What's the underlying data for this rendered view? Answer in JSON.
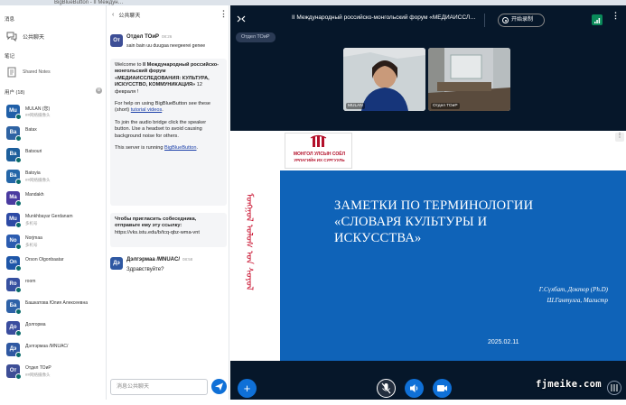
{
  "browser": {
    "tab_active": "BigBlueButton - II Междун…"
  },
  "sidebar": {
    "messages_title": "消息",
    "public_chat_label": "公共聊天",
    "notes_title": "笔记",
    "shared_notes_label": "Shared Notes",
    "users_title": "用户 (18)",
    "users": [
      {
        "initials": "Mu",
        "name": "MULAN (您)",
        "sub": "##网络摄像头",
        "color": "#1f5fa8"
      },
      {
        "initials": "Ba",
        "name": "Batax",
        "sub": "",
        "color": "#2e63a3"
      },
      {
        "initials": "Ba",
        "name": "Batsouri",
        "sub": "",
        "color": "#1d5f9c"
      },
      {
        "initials": "Ba",
        "name": "Batoyia",
        "sub": "##网络摄像头",
        "color": "#2466a8"
      },
      {
        "initials": "Ma",
        "name": "Mandakh",
        "sub": "",
        "color": "#4a3aa0"
      },
      {
        "initials": "Mu",
        "name": "Munkhbayar Gerdanam",
        "sub": "多机号",
        "color": "#2d4aa5"
      },
      {
        "initials": "No",
        "name": "Norjmaa",
        "sub": "多机号",
        "color": "#2b5cb0"
      },
      {
        "initials": "On",
        "name": "Orson Olgonbaatar",
        "sub": "",
        "color": "#1e56a8"
      },
      {
        "initials": "Ro",
        "name": "room",
        "sub": "",
        "color": "#3650a0"
      },
      {
        "initials": "Ба",
        "name": "Башкатова Юлия Алексеевна",
        "sub": "",
        "color": "#2e62a8"
      },
      {
        "initials": "До",
        "name": "Долгорма",
        "sub": "",
        "color": "#3a4d9e"
      },
      {
        "initials": "Дэ",
        "name": "Дэлгэрмаа /MNUAC/",
        "sub": "",
        "color": "#2f58a2"
      },
      {
        "initials": "От",
        "name": "Отдел ТОиР",
        "sub": "##网络摄像头",
        "color": "#3d4e96"
      }
    ]
  },
  "chat": {
    "back_label": "公共聊天",
    "msg1_initials": "От",
    "msg1_name": "Отдел ТОиР",
    "msg1_time": "08:26",
    "msg1_text": "sain bain uu duugaa neegeerei genee",
    "welcome_prefix": "Welcome to",
    "welcome_bold": "II Международный российско-монгольский форум «МЕДИАИССЛЕДОВАНИЯ: КУЛЬТУРА, ИСКУССТВО, КОММУНИКАЦИЯ»",
    "welcome_date": "12 февраля",
    "welcome_end": "!",
    "help_text": "For help on using BigBlueButton see these (short)",
    "tutorial_link": "tutorial videos",
    "audio_text": "To join the audio bridge click the speaker button. Use a headset to avoid causing background noise for others.",
    "server_text": "This server is running",
    "bbb_link": "BigBlueButton",
    "invite_title": "Чтобы пригласить собеседника, отправьте ему эту ссылку:",
    "invite_link": "https://vks.istu.edu/b/tcq-qbz-wma-vnt",
    "msg2_initials": "Дэ",
    "msg2_name": "Дэлгэрмаа /MNUAC/",
    "msg2_time": "08:58",
    "msg2_text": "Здравствуйте?",
    "input_placeholder": "消息公共聊天"
  },
  "main": {
    "title": "II Международный российско-монгольский форум «МЕДИАИССЛ…",
    "record_label": "开始录制",
    "presenter_tag": "Отдел ТОиР",
    "cam1_name": "MULAN",
    "cam2_name": "Отдел ТОиР"
  },
  "slide": {
    "logo_line1": "МОНГОЛ УЛСЫН СОЁЛ",
    "logo_line2": "УРЛАГИЙН ИХ СУРГУУЛЬ",
    "title_line1": "ЗАМЕТКИ ПО ТЕРМИНОЛОГИИ",
    "title_line2": "«СЛОВАРЯ КУЛЬТУРЫ И",
    "title_line3": "ИСКУССТВА»",
    "author1": "Г.Сүхбат, Доктор (Ph.D)",
    "author2": "Ш.Гантулга, Магистр",
    "date": "2025.02.11",
    "mongol_script": "ᠮᠣᠩᠭᠣᠯ ᠤᠯᠤᠰ ᠤᠨ ᠰᠣᠶᠣᠯ"
  },
  "watermark": "fjmeike.com",
  "colors": {
    "accent": "#0f70d7",
    "main_bg": "#06172a",
    "slide_blue": "#0f63b8",
    "status_green": "#0a6b6b"
  }
}
